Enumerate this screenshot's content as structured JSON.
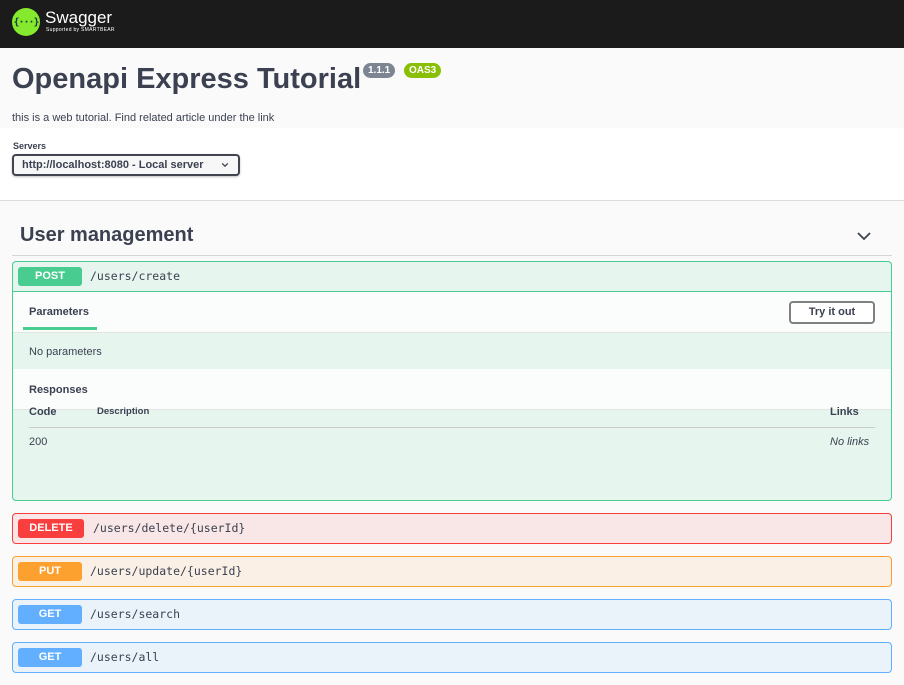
{
  "topbar": {
    "logo_mark": "{···}",
    "logo_name": "Swagger",
    "logo_sub": "Supported by SMARTBEAR",
    "background": "#1b1b1b",
    "logo_color": "#85ea2d"
  },
  "info": {
    "title": "Openapi Express Tutorial",
    "version": "1.1.1",
    "oas_badge": "OAS3",
    "description": "this is a web tutorial. Find related article under the link"
  },
  "servers": {
    "label": "Servers",
    "selected": "http://localhost:8080 - Local server"
  },
  "tag": {
    "name": "User management",
    "icon": "chevron-down-icon"
  },
  "operations": [
    {
      "method": "POST",
      "path": "/users/create",
      "color": "#49cc90",
      "expanded": true,
      "parameters_tab": "Parameters",
      "try_it_out": "Try it out",
      "no_parameters": "No parameters",
      "responses_title": "Responses",
      "columns": {
        "code": "Code",
        "description": "Description",
        "links": "Links"
      },
      "responses": [
        {
          "code": "200",
          "description": "",
          "links": "No links"
        }
      ]
    },
    {
      "method": "DELETE",
      "path": "/users/delete/{userId}",
      "color": "#f93e3e"
    },
    {
      "method": "PUT",
      "path": "/users/update/{userId}",
      "color": "#fca130"
    },
    {
      "method": "GET",
      "path": "/users/search",
      "color": "#61affe"
    },
    {
      "method": "GET",
      "path": "/users/all",
      "color": "#61affe"
    }
  ]
}
